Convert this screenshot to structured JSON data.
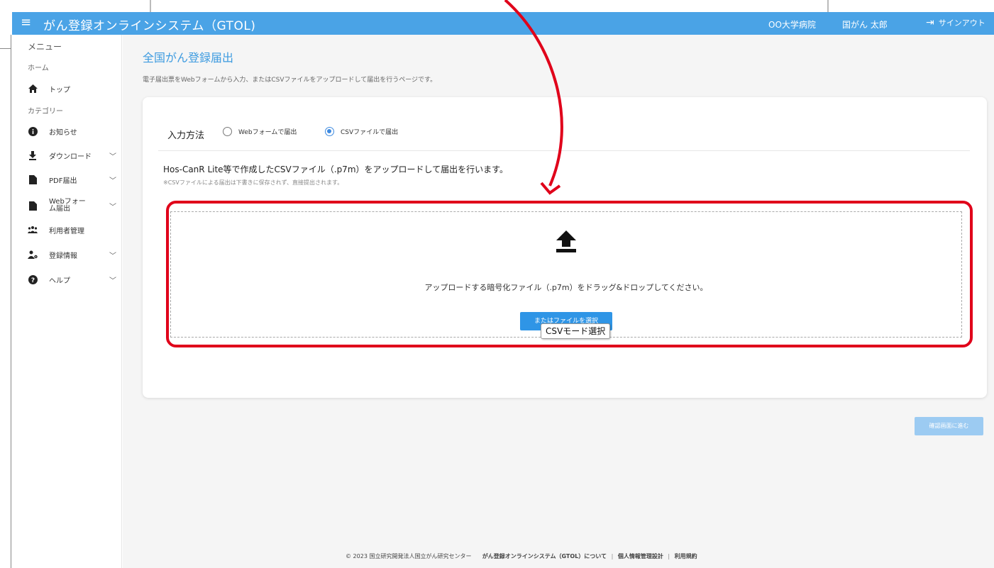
{
  "header": {
    "menu_icon": "hamburger-icon",
    "title": "がん登録オンラインシステム（GTOL)",
    "hospital": "OO大学病院",
    "user": "国がん 太郎",
    "signout_icon": "signout-icon",
    "signout_label": "サインアウト"
  },
  "sidebar": {
    "menu_label": "メニュー",
    "home_label": "ホーム",
    "top_label": "トップ",
    "category_label": "カテゴリー",
    "items": [
      {
        "label": "お知らせ",
        "icon": "info-icon",
        "expandable": false
      },
      {
        "label": "ダウンロード",
        "icon": "download-icon",
        "expandable": true
      },
      {
        "label": "PDF届出",
        "icon": "file-icon",
        "expandable": true
      },
      {
        "label": "Webフォーム届出",
        "icon": "file-icon",
        "expandable": true
      },
      {
        "label": "利用者管理",
        "icon": "users-icon",
        "expandable": false
      },
      {
        "label": "登録情報",
        "icon": "user-gear-icon",
        "expandable": true
      },
      {
        "label": "ヘルプ",
        "icon": "help-icon",
        "expandable": true
      }
    ]
  },
  "main": {
    "title": "全国がん登録届出",
    "description": "電子届出票をWebフォームから入力、またはCSVファイルをアップロードして届出を行うページです。",
    "input_method_label": "入力方法",
    "radio_web": "Webフォームで届出",
    "radio_csv": "CSVファイルで届出",
    "selected": "csv",
    "upload_note": "Hos-CanR Lite等で作成したCSVファイル（.p7m）をアップロードして届出を行います。",
    "upload_sub": "※CSVファイルによる届出は下書きに保存されず、直接提出されます。",
    "drop_text": "アップロードする暗号化ファイル（.p7m）をドラッグ&ドロップしてください。",
    "select_button": "またはファイルを選択",
    "tooltip": "CSVモード選択",
    "confirm_button": "確認画面に進む"
  },
  "footer": {
    "copyright": "© 2023 国立研究開発法人国立がん研究センター",
    "link_about": "がん登録オンラインシステム（GTOL）について",
    "link_privacy": "個人情報管理設計",
    "link_terms": "利用規約"
  },
  "colors": {
    "header": "#4aa3e6",
    "accent": "#3d9be0",
    "button": "#2f95e6",
    "highlight": "#e0001a"
  }
}
